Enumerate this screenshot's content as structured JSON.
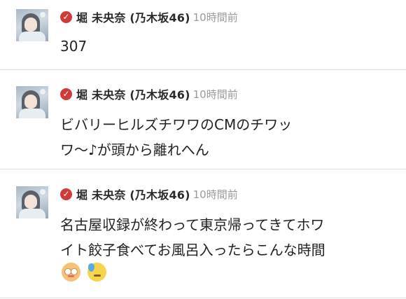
{
  "posts": [
    {
      "author": "堀 未央奈 (乃木坂46)",
      "verified_icon": "verified-check-icon",
      "time": "10時間前",
      "text": "307"
    },
    {
      "author": "堀 未央奈 (乃木坂46)",
      "verified_icon": "verified-check-icon",
      "time": "10時間前",
      "text": "ビバリーヒルズチワワのCMのチワッ\nワ〜♪が頭から離れへん"
    },
    {
      "author": "堀 未央奈 (乃木坂46)",
      "verified_icon": "verified-check-icon",
      "time": "10時間前",
      "text": "名古屋収録が終わって東京帰ってきてホワ\nイト餃子食べてお風呂入ったらこんな時間",
      "emojis": [
        "flushed-face-icon",
        "sweat-face-icon"
      ]
    }
  ],
  "colors": {
    "verified": "#d23a3a",
    "time": "#9a9a9a",
    "divider": "#dedede"
  }
}
